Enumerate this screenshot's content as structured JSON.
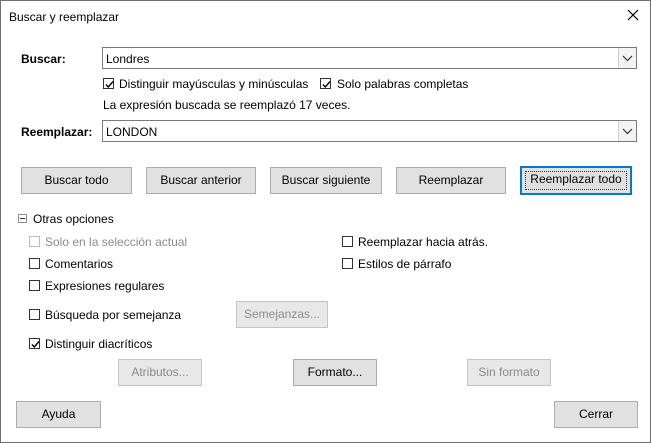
{
  "window": {
    "title": "Buscar y reemplazar"
  },
  "search": {
    "label": "Buscar:",
    "value": "Londres"
  },
  "options_top": {
    "match_case": "Distinguir mayúsculas y minúsculas",
    "whole_words": "Solo palabras completas"
  },
  "status": "La expresión buscada se reemplazó 17 veces.",
  "replace": {
    "label": "Reemplazar:",
    "value": "LONDON"
  },
  "buttons": {
    "find_all": "Buscar todo",
    "find_prev": "Buscar anterior",
    "find_next": "Buscar siguiente",
    "replace": "Reemplazar",
    "replace_all": "Reemplazar todo"
  },
  "other_options": {
    "header": "Otras opciones",
    "current_selection": "Solo en la selección actual",
    "comments": "Comentarios",
    "regex": "Expresiones regulares",
    "similarity": "Búsqueda por semejanza",
    "similarities_button": "Semejanzas...",
    "diacritics": "Distinguir diacríticos",
    "replace_backwards": "Reemplazar hacia atrás.",
    "paragraph_styles": "Estilos de párrafo",
    "attributes_button": "Atributos...",
    "format_button": "Formato...",
    "no_format_button": "Sin formato"
  },
  "footer": {
    "help": "Ayuda",
    "close": "Cerrar"
  },
  "states": {
    "match_case": true,
    "whole_words": true,
    "current_selection": false,
    "comments": false,
    "regex": false,
    "similarity": false,
    "diacritics": true,
    "replace_backwards": false,
    "paragraph_styles": false
  }
}
